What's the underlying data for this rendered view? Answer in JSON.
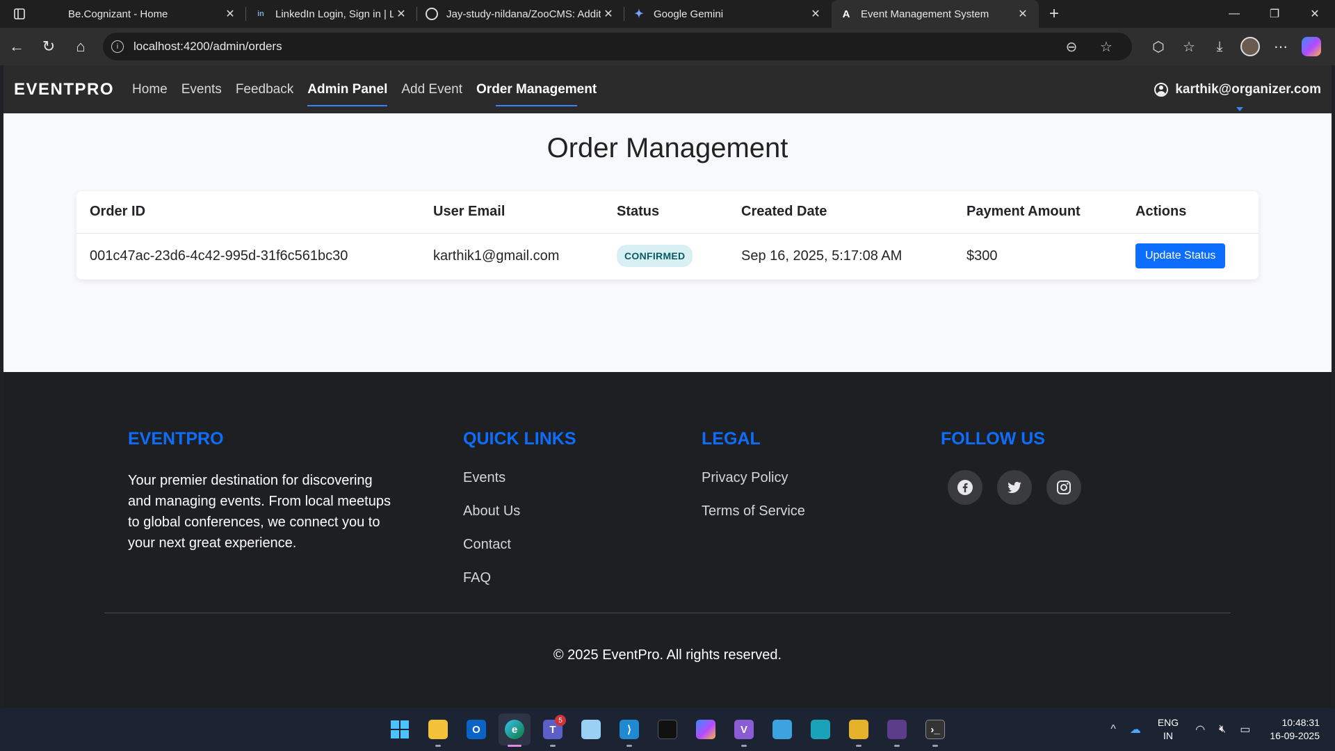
{
  "browser": {
    "tabs": [
      {
        "title": "Be.Cognizant - Home",
        "favicon": "cognizant-icon"
      },
      {
        "title": "LinkedIn Login, Sign in | LinkedIn",
        "favicon": "linkedin-icon"
      },
      {
        "title": "Jay-study-nildana/ZooCMS: Addit",
        "favicon": "github-icon"
      },
      {
        "title": "Google Gemini",
        "favicon": "gemini-icon"
      },
      {
        "title": "Event Management System",
        "favicon": "angular-icon"
      }
    ],
    "url": "localhost:4200/admin/orders"
  },
  "navbar": {
    "brand": "EVENTPRO",
    "links": [
      "Home",
      "Events",
      "Feedback",
      "Admin Panel",
      "Add Event",
      "Order Management"
    ],
    "user": "karthik@organizer.com"
  },
  "main": {
    "title": "Order Management",
    "table": {
      "headers": [
        "Order ID",
        "User Email",
        "Status",
        "Created Date",
        "Payment Amount",
        "Actions"
      ],
      "rows": [
        {
          "order_id": "001c47ac-23d6-4c42-995d-31f6c561bc30",
          "email": "karthik1@gmail.com",
          "status": "CONFIRMED",
          "created": "Sep 16, 2025, 5:17:08 AM",
          "amount": "$300",
          "action": "Update Status"
        }
      ]
    }
  },
  "footer": {
    "brand_heading": "EVENTPRO",
    "description": "Your premier destination for discovering and managing events. From local meetups to global conferences, we connect you to your next great experience.",
    "quick_links_heading": "QUICK LINKS",
    "quick_links": [
      "Events",
      "About Us",
      "Contact",
      "FAQ"
    ],
    "legal_heading": "LEGAL",
    "legal_links": [
      "Privacy Policy",
      "Terms of Service"
    ],
    "follow_heading": "FOLLOW US",
    "social": [
      "facebook-icon",
      "twitter-icon",
      "instagram-icon"
    ],
    "copyright": "© 2025 EventPro. All rights reserved."
  },
  "taskbar": {
    "teams_badge": "5",
    "lang_1": "ENG",
    "lang_2": "IN",
    "time": "10:48:31",
    "date": "16-09-2025"
  },
  "colors": {
    "accent": "#0d6efd",
    "navbar_bg": "#2b2b2b",
    "footer_bg": "#1e1f22",
    "status_bg": "#d8f0f3"
  }
}
